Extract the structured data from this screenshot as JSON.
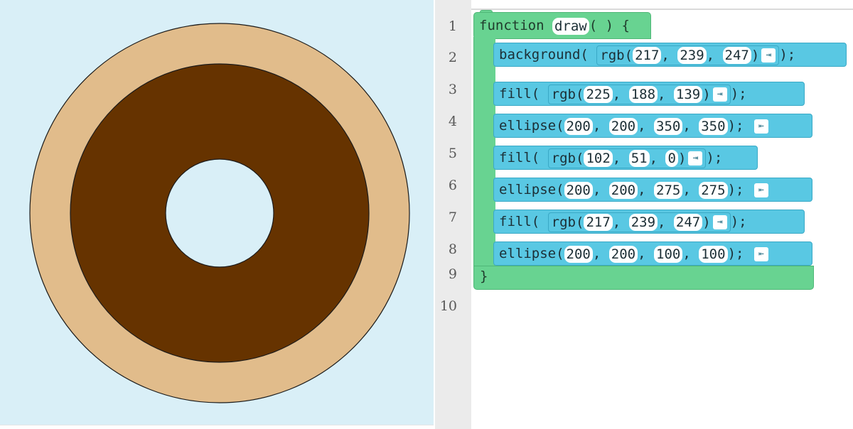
{
  "canvas": {
    "background": "#d9eff7",
    "outer_ring_color": "#e1bc8b",
    "donut_color": "#663300",
    "hole_color": "#d9eff7"
  },
  "gutter": {
    "line_numbers": [
      "1",
      "2",
      "3",
      "4",
      "5",
      "6",
      "7",
      "8",
      "9",
      "10"
    ]
  },
  "code": {
    "function_keyword": "function",
    "function_name": "draw",
    "function_parens": "( )",
    "open_brace": "{",
    "close_brace": "}",
    "lines": [
      {
        "fn": "background",
        "inner_fn": "rgb",
        "args": [
          "217",
          "239",
          "247"
        ]
      },
      {
        "fn": "fill",
        "inner_fn": "rgb",
        "args": [
          "225",
          "188",
          "139"
        ]
      },
      {
        "fn": "ellipse",
        "args": [
          "200",
          "200",
          "350",
          "350"
        ]
      },
      {
        "fn": "fill",
        "inner_fn": "rgb",
        "args": [
          "102",
          "51",
          "0"
        ]
      },
      {
        "fn": "ellipse",
        "args": [
          "200",
          "200",
          "275",
          "275"
        ]
      },
      {
        "fn": "fill",
        "inner_fn": "rgb",
        "args": [
          "217",
          "239",
          "247"
        ]
      },
      {
        "fn": "ellipse",
        "args": [
          "200",
          "200",
          "100",
          "100"
        ]
      }
    ],
    "collapse_arrow": "⇥",
    "expand_arrow": "⇤",
    "open_paren": "(",
    "close_paren": ")",
    "close_call": ");",
    "semicolon": ";",
    "comma": ","
  }
}
